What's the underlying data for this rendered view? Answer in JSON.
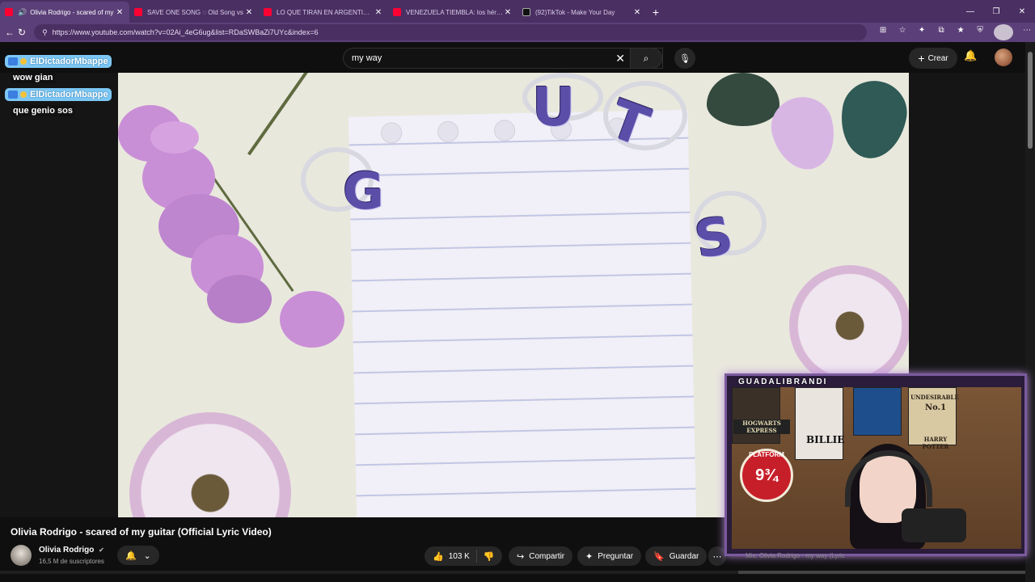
{
  "browser": {
    "tabs": [
      {
        "title": "Olivia Rodrigo - scared of my",
        "favicon": "youtube",
        "active": true,
        "audio": true
      },
      {
        "title": "SAVE ONE SONG ◌ Old Song vs",
        "favicon": "youtube",
        "active": false
      },
      {
        "title": "LO QUE TIRAN EN ARGENTINA EN",
        "favicon": "youtube",
        "active": false
      },
      {
        "title": "VENEZUELA TIEMBLA: los héroes d",
        "favicon": "youtube",
        "active": false
      },
      {
        "title": "(92)TikTok - Make Your Day",
        "favicon": "tiktok",
        "active": false
      }
    ],
    "url": "https://www.youtube.com/watch?v=02Ai_4eG6ug&list=RDaSWBaZi7UYc&index=6",
    "accent": "#5b3f78"
  },
  "youtube": {
    "search_value": "my way",
    "create_label": "Crear"
  },
  "chat": [
    {
      "user": "ElDictadorMbappe",
      "message": "wow gian"
    },
    {
      "user": "ElDictadorMbappe",
      "message": "que genio sos"
    }
  ],
  "video": {
    "title": "Olivia Rodrigo - scared of my guitar (Official Lyric Video)",
    "channel": "Olivia Rodrigo",
    "subscribers": "16,5 M de suscriptores",
    "likes": "103 K",
    "share_label": "Compartir",
    "ask_label": "Preguntar",
    "save_label": "Guardar",
    "ring_letters": [
      "U",
      "T",
      "G",
      "S"
    ]
  },
  "stream": {
    "streamer": "GUADALIBRANDI",
    "posters": {
      "hogwarts": "HOGWARTS EXPRESS",
      "billie": "BILLIE",
      "platform_label": "PLATFORM",
      "platform_number": "9¾",
      "undesirable": "UNDESIRABLE",
      "undesirable_no": "No.1",
      "harry": "HARRY POTTER"
    },
    "caption": "Mix: Olivia Rodrigo - my way (Lyric"
  }
}
